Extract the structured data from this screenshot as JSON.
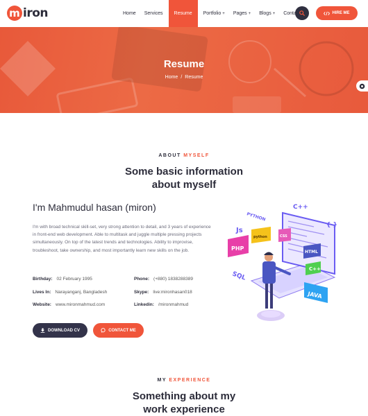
{
  "brand": {
    "logo_letter": "m",
    "logo_rest": "iron"
  },
  "nav": {
    "items": [
      {
        "label": "Home",
        "caret": ""
      },
      {
        "label": "Services",
        "caret": ""
      },
      {
        "label": "Resume",
        "caret": ""
      },
      {
        "label": "Portfolio",
        "caret": "+"
      },
      {
        "label": "Pages",
        "caret": "+"
      },
      {
        "label": "Blogs",
        "caret": "+"
      },
      {
        "label": "Contact",
        "caret": ""
      }
    ],
    "active": "Resume",
    "hire_label": "HIRE ME"
  },
  "banner": {
    "title": "Resume",
    "breadcrumb": {
      "home": "Home",
      "separator": "/",
      "current": "Resume"
    }
  },
  "about": {
    "label_plain": "ABOUT",
    "label_accent": "MYSELF",
    "title_line1": "Some basic information",
    "title_line2": "about myself",
    "name": "I'm Mahmudul hasan (miron)",
    "bio": "I'm with broad technical skill-set, very strong attention to detail, and 3 years of experience in front-end web development. Able to multitask and juggle multiple pressing projects simultaneously. On top of the latest trends and technologies. Ability to improvise, troubleshoot, take ownership, and most importantly learn new skills on the job.",
    "details": [
      {
        "label": "Birthday:",
        "value": "02 February 1995"
      },
      {
        "label": "Phone:",
        "value": "(+880) 1838288389"
      },
      {
        "label": "Lives In:",
        "value": "Narayanganj, Bangladesh"
      },
      {
        "label": "Skype:",
        "value": "live:mironhasan018"
      },
      {
        "label": "Website:",
        "value": "www.mironmahmud.com"
      },
      {
        "label": "Linkedin:",
        "value": "/mironmahmud"
      }
    ],
    "download_cv": "DOWNLOAD CV",
    "contact_me": "CONTACT ME"
  },
  "illustration_tags": [
    "C++",
    "PYTHON",
    "{ }",
    "Js",
    "PHP",
    "python",
    "CSS",
    "HTML",
    "C++",
    "SQL",
    "JAVA"
  ],
  "experience": {
    "label_plain": "MY",
    "label_accent": "EXPERIENCE",
    "title_line1": "Something about my",
    "title_line2": "work experience"
  },
  "colors": {
    "accent": "#f0553a",
    "dark": "#33334a",
    "text": "#2c2c3a"
  },
  "icons": {
    "search": "search-icon",
    "hire": "code-icon",
    "download": "download-icon",
    "contact": "chat-icon",
    "side": "gear-icon"
  }
}
